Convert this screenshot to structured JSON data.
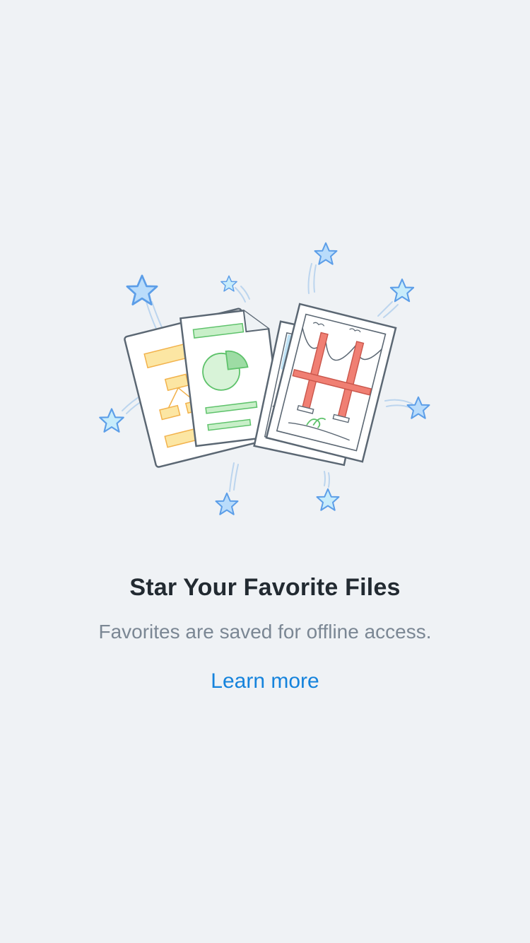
{
  "empty_state": {
    "title": "Star Your Favorite Files",
    "subtitle": "Favorites are saved for offline access.",
    "learn_more_label": "Learn more"
  },
  "illustration": {
    "icon": "favorite-files-illustration",
    "star_icon": "star-icon"
  },
  "colors": {
    "background": "#eff2f5",
    "title": "#222a31",
    "subtitle": "#7b8794",
    "link": "#1583dc",
    "star_fill": "#b9dcfb",
    "star_stroke": "#5c9ee8"
  }
}
